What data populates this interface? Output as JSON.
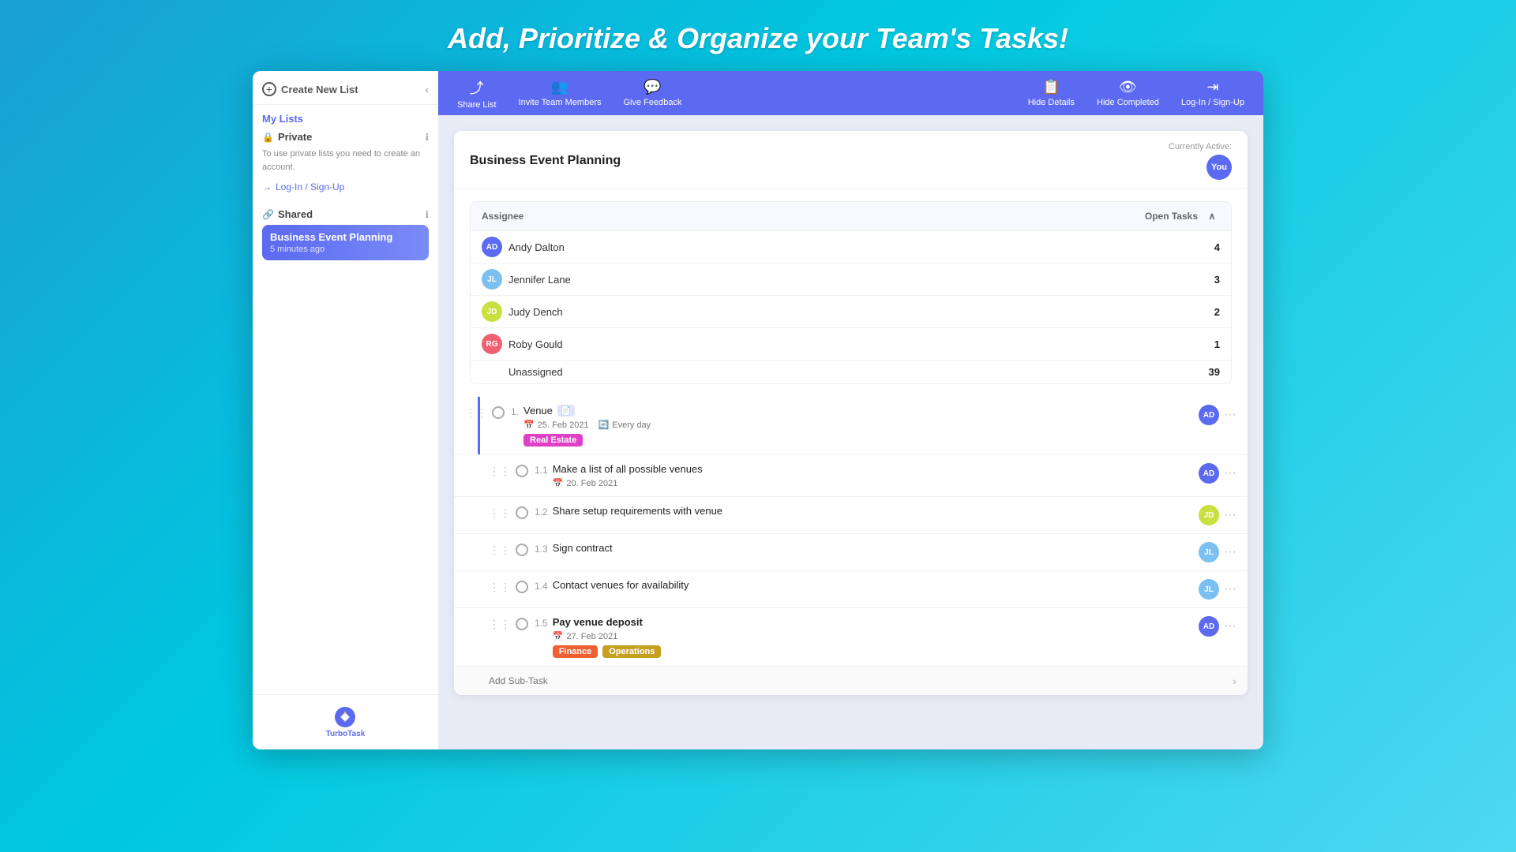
{
  "page": {
    "heading": "Add, Prioritize & Organize your Team's Tasks!"
  },
  "sidebar": {
    "create_new_list": "Create New List",
    "my_lists": "My Lists",
    "private_section": "Private",
    "private_info": "To use private lists you need to create an account.",
    "login_link": "Log-In / Sign-Up",
    "shared_section": "Shared",
    "active_list_name": "Business Event Planning",
    "active_list_time": "5 minutes ago",
    "logo_text": "TurboTask"
  },
  "topbar": {
    "share_list": "Share List",
    "invite_team": "Invite Team Members",
    "give_feedback": "Give Feedback",
    "hide_details": "Hide Details",
    "hide_completed": "Hide Completed",
    "login": "Log-In / Sign-Up"
  },
  "main": {
    "title": "Business Event Planning",
    "currently_active_label": "Currently Active:",
    "you_badge": "You",
    "assignee_table": {
      "col1": "Assignee",
      "col2": "Open Tasks",
      "rows": [
        {
          "initials": "AD",
          "name": "Andy Dalton",
          "count": 4,
          "avatar_class": "avatar-ad"
        },
        {
          "initials": "JL",
          "name": "Jennifer Lane",
          "count": 3,
          "avatar_class": "avatar-jl"
        },
        {
          "initials": "JD",
          "name": "Judy Dench",
          "count": 2,
          "avatar_class": "avatar-jd"
        },
        {
          "initials": "RG",
          "name": "Roby Gould",
          "count": 1,
          "avatar_class": "avatar-rg"
        }
      ],
      "unassigned_label": "Unassigned",
      "unassigned_count": 39
    },
    "tasks": [
      {
        "id": "task-1",
        "number": "1.",
        "title": "Venue",
        "has_doc": true,
        "date": "25. Feb 2021",
        "repeat": "Every day",
        "tags": [
          "Real Estate"
        ],
        "assignee_initials": "AD",
        "assignee_class": "avatar-ad",
        "is_main": true,
        "subtasks": [
          {
            "id": "task-1-1",
            "number": "1.1",
            "title": "Make a list of all possible venues",
            "date": "20. Feb 2021",
            "assignee_initials": "AD",
            "assignee_class": "avatar-ad"
          },
          {
            "id": "task-1-2",
            "number": "1.2",
            "title": "Share setup requirements with venue",
            "date": null,
            "assignee_initials": "JD",
            "assignee_class": "avatar-jd"
          },
          {
            "id": "task-1-3",
            "number": "1.3",
            "title": "Sign contract",
            "date": null,
            "assignee_initials": "JL",
            "assignee_class": "avatar-jl"
          },
          {
            "id": "task-1-4",
            "number": "1.4",
            "title": "Contact venues for availability",
            "date": null,
            "assignee_initials": "JL",
            "assignee_class": "avatar-jl"
          },
          {
            "id": "task-1-5",
            "number": "1.5",
            "title": "Pay venue deposit",
            "bold": true,
            "date": "27. Feb 2021",
            "tags": [
              "Finance",
              "Operations"
            ],
            "assignee_initials": "AD",
            "assignee_class": "avatar-ad"
          }
        ]
      }
    ],
    "add_subtask_placeholder": "Add Sub-Task"
  }
}
